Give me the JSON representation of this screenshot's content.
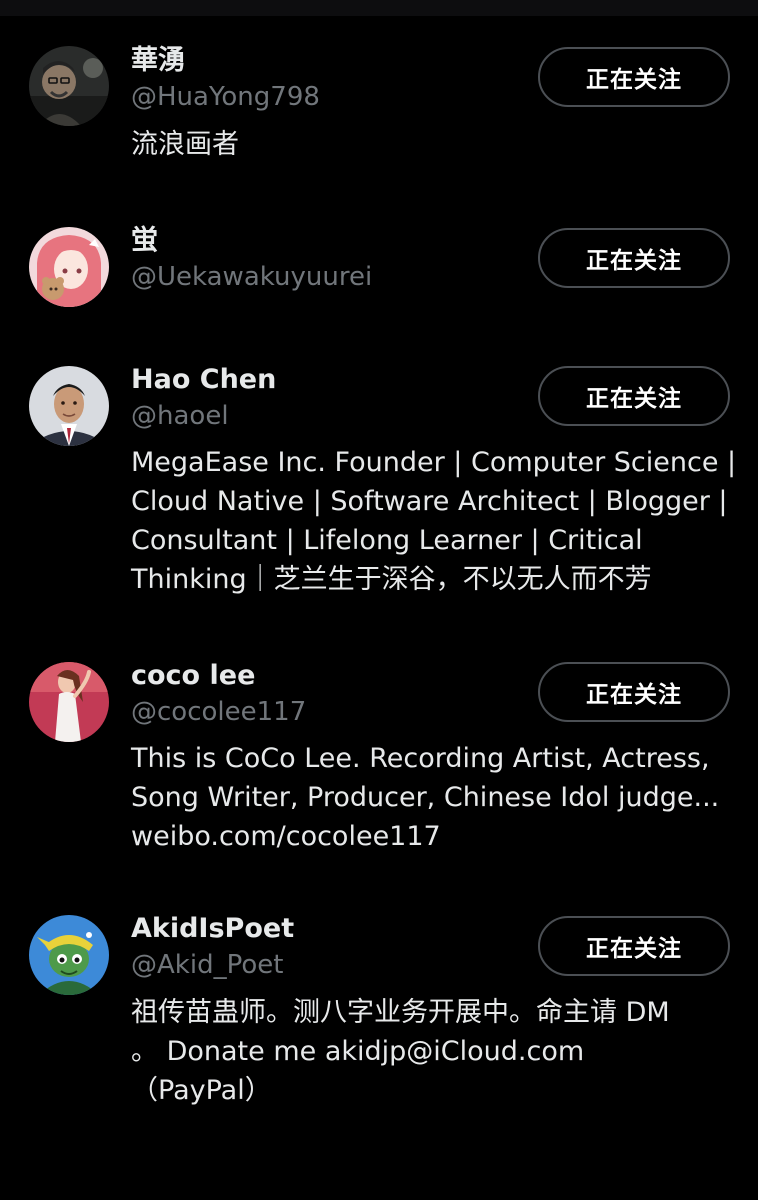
{
  "following_list": {
    "users": [
      {
        "name": "華湧",
        "handle": "@HuaYong798",
        "bio": "流浪画者",
        "button_label": "正在关注",
        "avatar_icon": "man-with-glasses-avatar"
      },
      {
        "name": "蛍",
        "handle": "@Uekawakuyuurei",
        "bio": "",
        "button_label": "正在关注",
        "avatar_icon": "anime-girl-pink-hair-avatar"
      },
      {
        "name": "Hao Chen",
        "handle": "@haoel",
        "bio": "MegaEase Inc. Founder | Computer Science |\nCloud Native | Software Architect | Blogger |\nConsultant | Lifelong Learner | Critical\nThinking｜芝兰生于深谷，不以无人而不芳",
        "button_label": "正在关注",
        "avatar_icon": "man-in-suit-avatar"
      },
      {
        "name": "coco lee",
        "handle": "@cocolee117",
        "bio": "This is CoCo Lee. Recording Artist, Actress,\nSong Writer, Producer, Chinese Idol judge...\nweibo.com/cocolee117",
        "button_label": "正在关注",
        "avatar_icon": "woman-white-dress-avatar"
      },
      {
        "name": "AkidIsPoet",
        "handle": "@Akid_Poet",
        "bio": "祖传苗蛊师。测八字业务开展中。命主请 DM\n。 Donate me akidjp@iCloud.com\n（PayPal）",
        "button_label": "正在关注",
        "avatar_icon": "cartoon-creature-avatar"
      }
    ]
  },
  "colors": {
    "background": "#000000",
    "primary_text": "#e7e9ea",
    "secondary_text": "#71767b",
    "button_border": "#4b4f54"
  }
}
